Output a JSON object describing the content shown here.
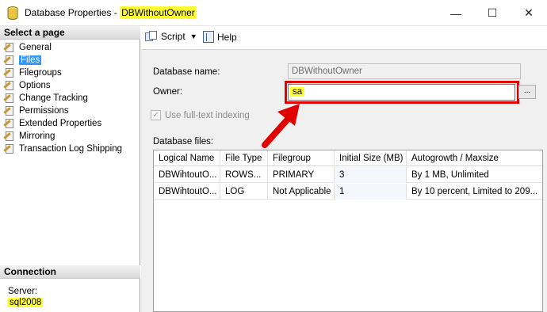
{
  "window": {
    "title_prefix": "Database Properties - ",
    "title_db": "DBWithoutOwner",
    "min_glyph": "—",
    "max_glyph": "☐",
    "close_glyph": "✕"
  },
  "left_panel": {
    "select_page_header": "Select a page",
    "pages": [
      {
        "label": "General",
        "icon": "page-wrench-icon"
      },
      {
        "label": "Files",
        "icon": "page-wrench-icon",
        "selected": true
      },
      {
        "label": "Filegroups",
        "icon": "page-wrench-icon"
      },
      {
        "label": "Options",
        "icon": "page-wrench-icon"
      },
      {
        "label": "Change Tracking",
        "icon": "page-wrench-icon"
      },
      {
        "label": "Permissions",
        "icon": "page-wrench-icon"
      },
      {
        "label": "Extended Properties",
        "icon": "page-wrench-icon"
      },
      {
        "label": "Mirroring",
        "icon": "page-wrench-icon"
      },
      {
        "label": "Transaction Log Shipping",
        "icon": "page-wrench-icon"
      }
    ],
    "connection_header": "Connection",
    "server_label": "Server:",
    "server_value": "sql2008"
  },
  "toolbar": {
    "script_label": "Script",
    "caret": "▼",
    "help_label": "Help"
  },
  "form": {
    "database_name_label": "Database name:",
    "database_name_value": "DBWithoutOwner",
    "owner_label": "Owner:",
    "owner_value": "sa",
    "browse_label": "...",
    "fulltext_label": "Use full-text indexing",
    "fulltext_checked": true,
    "database_files_label": "Database files:"
  },
  "files_table": {
    "columns": [
      "Logical Name",
      "File Type",
      "Filegroup",
      "Initial Size (MB)",
      "Autogrowth / Maxsize"
    ],
    "rows": [
      [
        "DBWihtoutO...",
        "ROWS...",
        "PRIMARY",
        "3",
        "By 1 MB, Unlimited"
      ],
      [
        "DBWihtoutO...",
        "LOG",
        "Not Applicable",
        "1",
        "By 10 percent, Limited to 209..."
      ]
    ]
  },
  "colors": {
    "highlight": "#ffff33",
    "annotation_red": "#e00000",
    "selection_blue": "#3399ff"
  }
}
